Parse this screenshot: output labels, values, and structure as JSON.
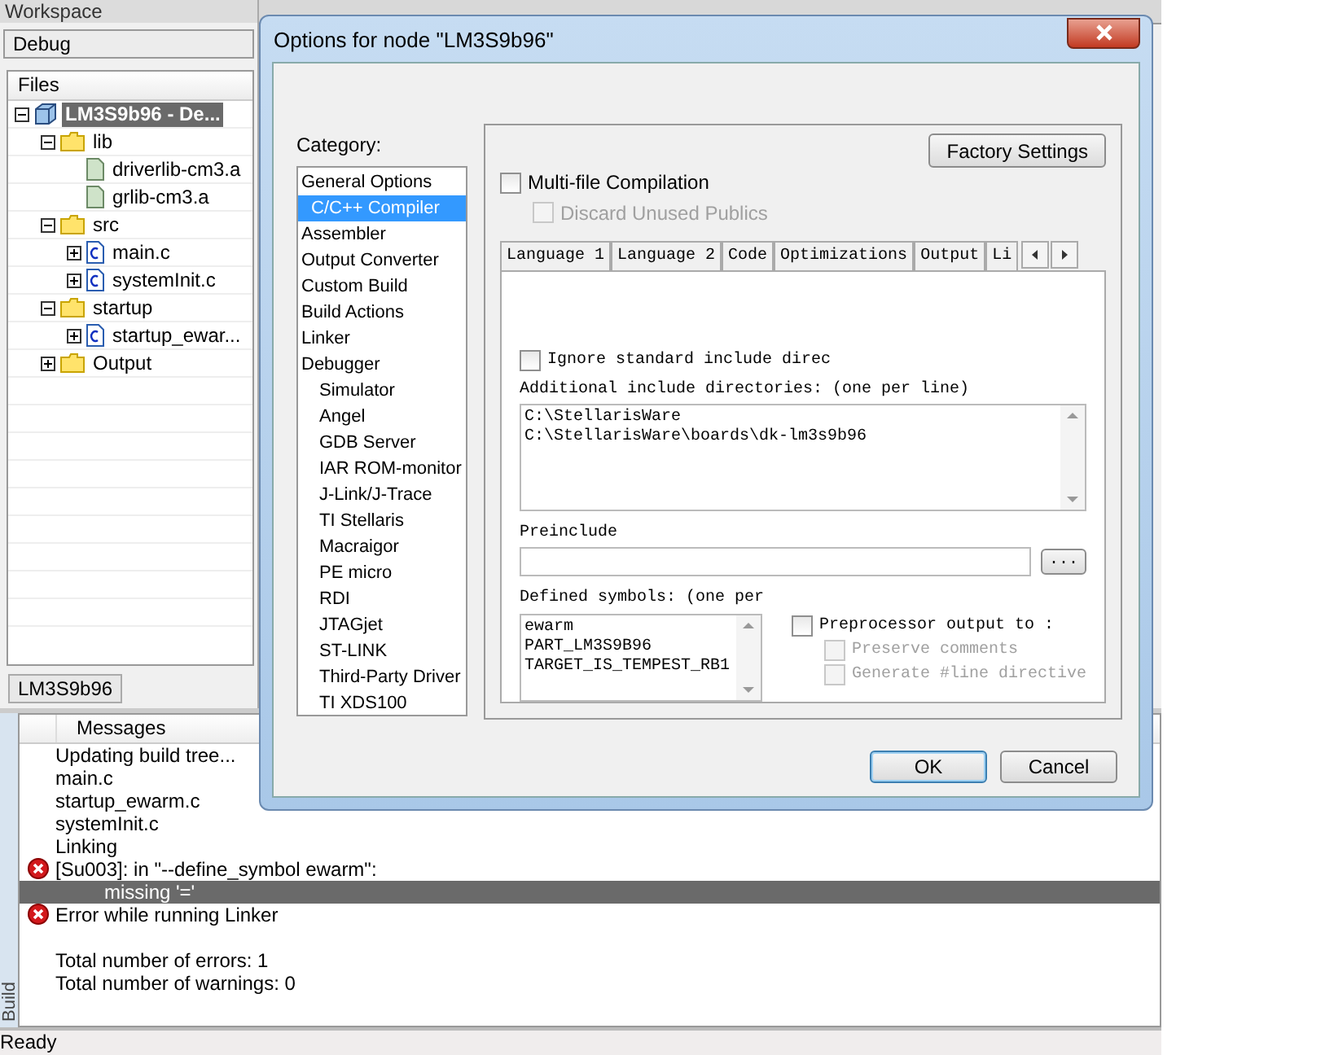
{
  "workspace": {
    "title": "Workspace",
    "config": "Debug",
    "files_header": "Files",
    "tree": [
      {
        "label": "LM3S9b96 - De...",
        "kind": "project",
        "expanded": true,
        "selected": true,
        "children": [
          {
            "label": "lib",
            "kind": "folder",
            "expanded": true,
            "children": [
              {
                "label": "driverlib-cm3.a",
                "kind": "lib"
              },
              {
                "label": "grlib-cm3.a",
                "kind": "lib"
              }
            ]
          },
          {
            "label": "src",
            "kind": "folder",
            "expanded": true,
            "children": [
              {
                "label": "main.c",
                "kind": "c",
                "expanded": false
              },
              {
                "label": "systemInit.c",
                "kind": "c",
                "expanded": false
              }
            ]
          },
          {
            "label": "startup",
            "kind": "folder",
            "expanded": true,
            "children": [
              {
                "label": "startup_ewar...",
                "kind": "c",
                "expanded": false
              }
            ]
          },
          {
            "label": "Output",
            "kind": "folder",
            "expanded": false
          }
        ]
      }
    ],
    "bottom_tab": "LM3S9b96"
  },
  "messages": {
    "panel_label": "Build",
    "header": "Messages",
    "rows": [
      {
        "text": "Updating build tree...",
        "kind": "info",
        "selected": false
      },
      {
        "text": "main.c",
        "kind": "info",
        "selected": false
      },
      {
        "text": "startup_ewarm.c",
        "kind": "info",
        "selected": false
      },
      {
        "text": "systemInit.c",
        "kind": "info",
        "selected": false
      },
      {
        "text": "Linking",
        "kind": "info",
        "selected": false
      },
      {
        "text": "[Su003]: in \"--define_symbol ewarm\":",
        "kind": "error",
        "selected": false
      },
      {
        "text": "missing '='",
        "kind": "continuation",
        "selected": true
      },
      {
        "text": "Error while running Linker",
        "kind": "error",
        "selected": false
      },
      {
        "kind": "blank"
      },
      {
        "text": "Total number of errors: 1",
        "kind": "info",
        "selected": false
      },
      {
        "text": "Total number of warnings: 0",
        "kind": "info",
        "selected": false
      }
    ]
  },
  "status_bar": "Ready",
  "dialog": {
    "title": "Options for node \"LM3S9b96\"",
    "category_label": "Category:",
    "categories": [
      {
        "label": "General Options",
        "selected": false
      },
      {
        "label": "C/C++ Compiler",
        "selected": true
      },
      {
        "label": "Assembler",
        "selected": false
      },
      {
        "label": "Output Converter",
        "selected": false
      },
      {
        "label": "Custom Build",
        "selected": false
      },
      {
        "label": "Build Actions",
        "selected": false
      },
      {
        "label": "Linker",
        "selected": false
      },
      {
        "label": "Debugger",
        "selected": false,
        "children": [
          {
            "label": "Simulator",
            "selected": false
          },
          {
            "label": "Angel",
            "selected": false
          },
          {
            "label": "GDB Server",
            "selected": false
          },
          {
            "label": "IAR ROM-monitor",
            "selected": false
          },
          {
            "label": "J-Link/J-Trace",
            "selected": false
          },
          {
            "label": "TI Stellaris",
            "selected": false
          },
          {
            "label": "Macraigor",
            "selected": false
          },
          {
            "label": "PE micro",
            "selected": false
          },
          {
            "label": "RDI",
            "selected": false
          },
          {
            "label": "JTAGjet",
            "selected": false
          },
          {
            "label": "ST-LINK",
            "selected": false
          },
          {
            "label": "Third-Party Driver",
            "selected": false
          },
          {
            "label": "TI XDS100",
            "selected": false
          }
        ]
      }
    ],
    "factory_button": "Factory Settings",
    "multi_file": {
      "label": "Multi-file Compilation",
      "checked": false,
      "disabled": false
    },
    "discard": {
      "label": "Discard Unused Publics",
      "checked": false,
      "disabled": true
    },
    "tabs": [
      {
        "label": "Language 1",
        "selected": false
      },
      {
        "label": "Language 2",
        "selected": false
      },
      {
        "label": "Code",
        "selected": false
      },
      {
        "label": "Optimizations",
        "selected": false
      },
      {
        "label": "Output",
        "selected": false
      },
      {
        "label": "Li",
        "selected": false
      }
    ],
    "ignore_std": {
      "label": "Ignore standard include direc",
      "checked": false,
      "disabled": false
    },
    "include_label": "Additional include directories: (one per line)",
    "include_dirs": [
      "C:\\StellarisWare",
      "C:\\StellarisWare\\boards\\dk-lm3s9b96"
    ],
    "preinclude_label": "Preinclude",
    "browse_button": "...",
    "defined_label": "Defined symbols: (one per",
    "defined_symbols": [
      "ewarm",
      "PART_LM3S9B96",
      "TARGET_IS_TEMPEST_RB1"
    ],
    "preproc": {
      "label": "Preprocessor output to :",
      "checked": false,
      "disabled": false
    },
    "preserve": {
      "label": "Preserve comments",
      "checked": false,
      "disabled": true
    },
    "genline": {
      "label": "Generate #line directive",
      "checked": false,
      "disabled": true
    },
    "ok": "OK",
    "cancel": "Cancel"
  }
}
